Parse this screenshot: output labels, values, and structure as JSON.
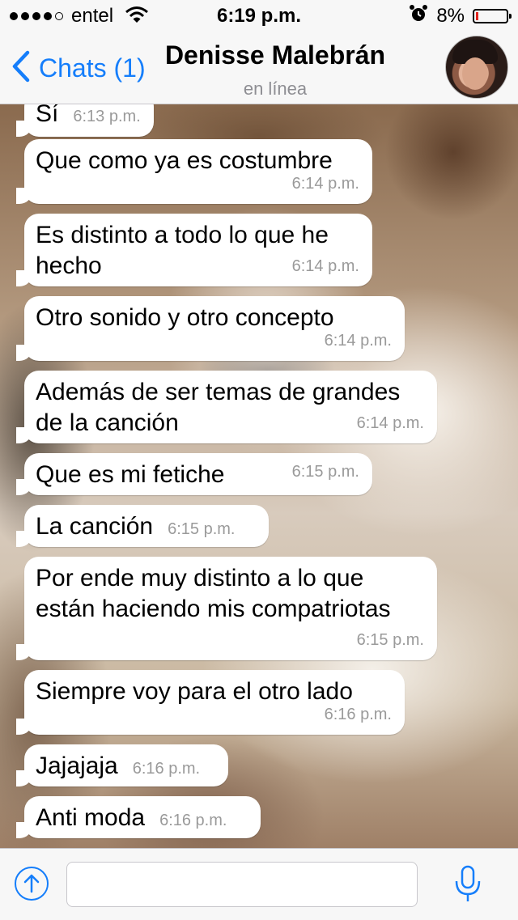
{
  "status_bar": {
    "carrier": "entel",
    "time": "6:19 p.m.",
    "battery": "8%",
    "battery_level": 0.08,
    "signal_bars_filled": 4,
    "signal_bars_total": 5
  },
  "nav": {
    "back_label": "Chats (1)",
    "contact_name": "Denisse Malebrán",
    "contact_status": "en línea"
  },
  "messages": [
    {
      "text": "Sí",
      "time": "6:13 p.m."
    },
    {
      "text": "Que como ya es costumbre",
      "time": "6:14 p.m."
    },
    {
      "text": "Es distinto a todo lo que he hecho",
      "time": "6:14 p.m."
    },
    {
      "text": "Otro sonido y otro concepto",
      "time": "6:14 p.m."
    },
    {
      "text": "Además de ser temas de grandes de la canción",
      "time": "6:14 p.m."
    },
    {
      "text": "Que es mi fetiche",
      "time": "6:15 p.m."
    },
    {
      "text": "La canción",
      "time": "6:15 p.m."
    },
    {
      "text": "Por ende muy distinto a lo que están haciendo mis compatriotas",
      "time": "6:15 p.m."
    },
    {
      "text": "Siempre voy para el otro lado",
      "time": "6:16 p.m."
    },
    {
      "text": "Jajajaja",
      "time": "6:16 p.m."
    },
    {
      "text": "Anti moda",
      "time": "6:16 p.m."
    }
  ],
  "input": {
    "placeholder": "",
    "value": ""
  },
  "colors": {
    "accent": "#157efb",
    "battery_low": "#e0231c",
    "bubble": "#ffffff",
    "timestamp": "#9a9a9a"
  },
  "icons": {
    "back": "chevron-left-icon",
    "wifi": "wifi-icon",
    "alarm": "alarm-clock-icon",
    "battery": "battery-icon",
    "attach": "arrow-up-circle-icon",
    "mic": "microphone-icon"
  }
}
